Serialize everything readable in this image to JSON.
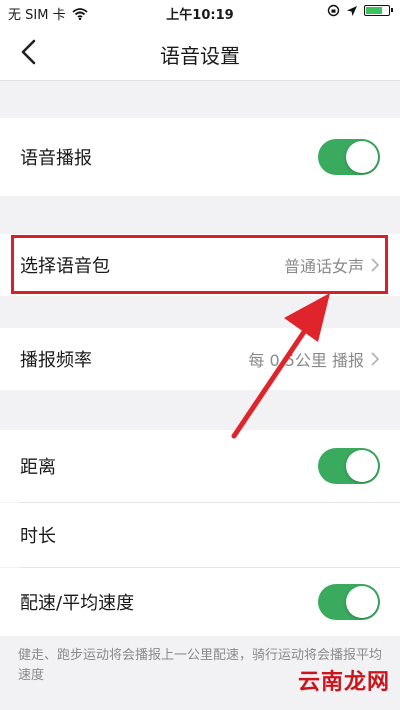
{
  "status_bar": {
    "carrier": "无 SIM 卡",
    "time": "上午10:19",
    "battery_level": 0.75,
    "icons": [
      "wifi-icon",
      "orientation-lock-icon",
      "location-arrow-icon",
      "battery-icon"
    ]
  },
  "nav": {
    "title": "语音设置",
    "back_icon": "chevron-left-icon"
  },
  "settings": {
    "voice_broadcast": {
      "label": "语音播报",
      "enabled": true
    },
    "voice_pack": {
      "label": "选择语音包",
      "value": "普通话女声"
    },
    "broadcast_frequency": {
      "label": "播报频率",
      "value": "每 0.5公里 播报"
    },
    "distance": {
      "label": "距离",
      "enabled": true
    },
    "duration": {
      "label": "时长"
    },
    "pace": {
      "label": "配速/平均速度",
      "enabled": true
    }
  },
  "footnote": "健走、跑步运动将会播报上一公里配速，骑行运动将会播报平均速度",
  "watermark": "云南龙网",
  "colors": {
    "toggle_on": "#3aaa5e",
    "highlight": "#d8202a",
    "secondary_text": "#8a8a8a",
    "background": "#f2f2f4"
  }
}
